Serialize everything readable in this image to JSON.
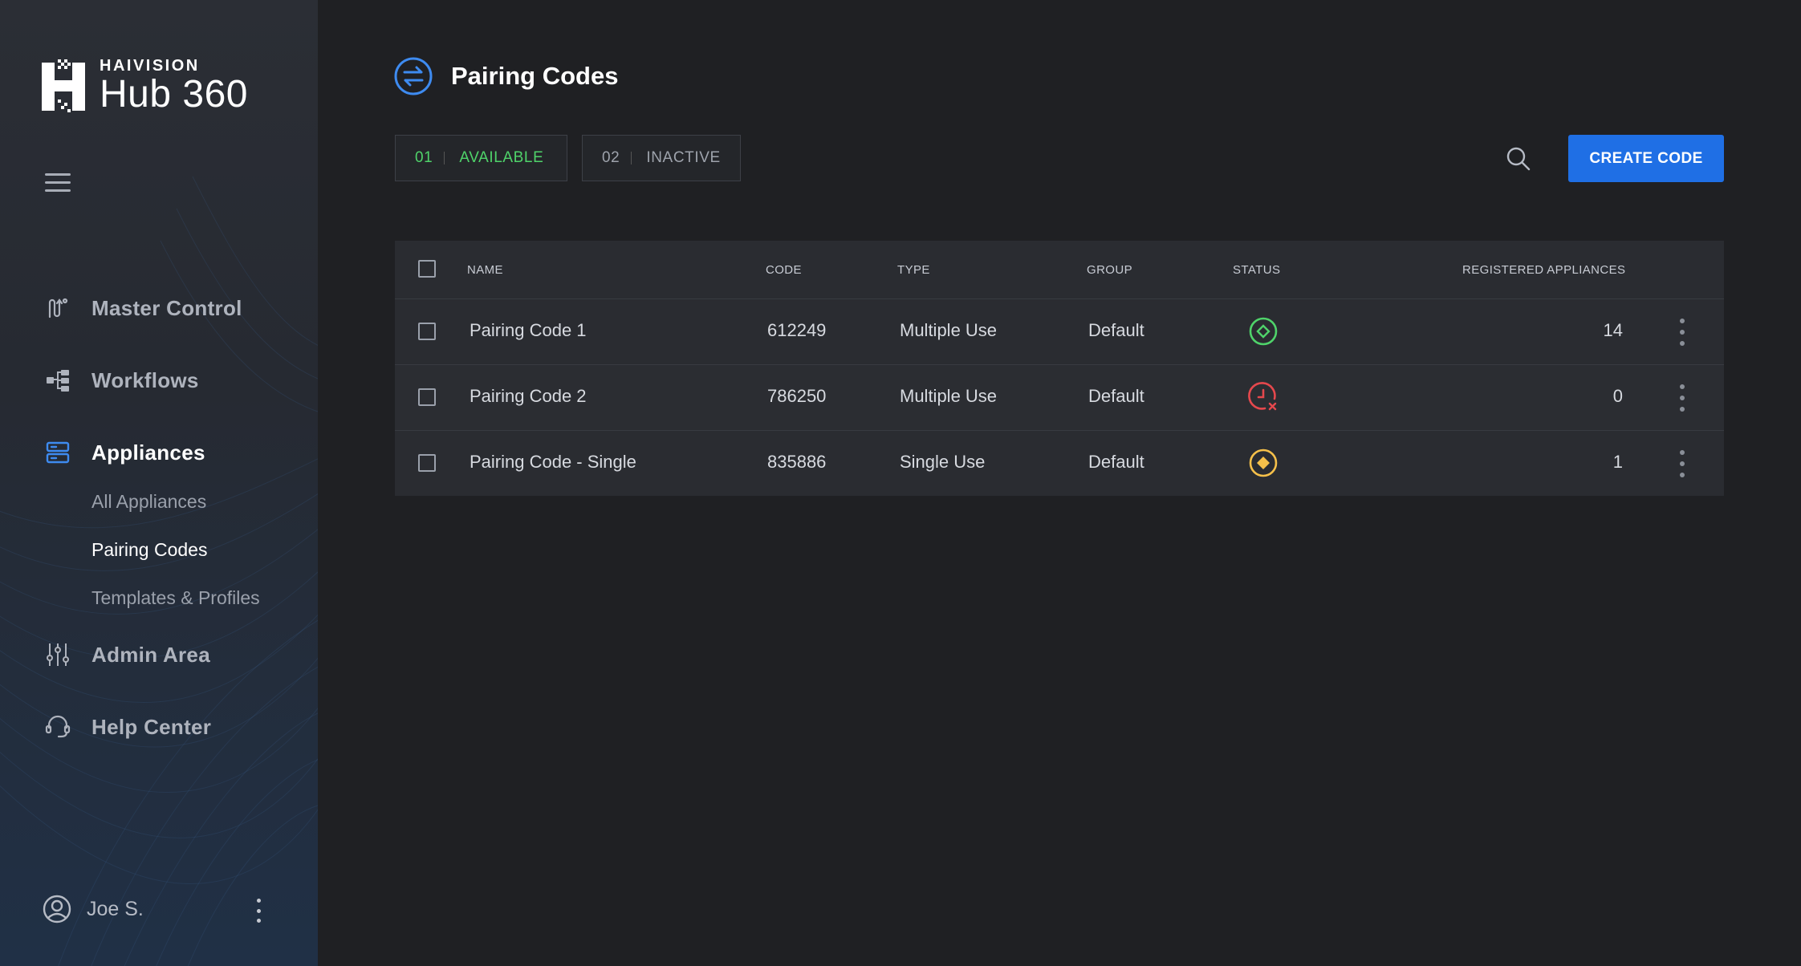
{
  "brand": {
    "company": "HAIVISION",
    "product": "Hub 360"
  },
  "sidebar": {
    "nav": [
      {
        "label": "Master Control",
        "icon": "master-control-icon"
      },
      {
        "label": "Workflows",
        "icon": "workflows-icon"
      },
      {
        "label": "Appliances",
        "icon": "appliances-icon",
        "active": true
      },
      {
        "label": "Admin Area",
        "icon": "sliders-icon"
      },
      {
        "label": "Help Center",
        "icon": "headset-icon"
      }
    ],
    "appliance_sub": [
      {
        "label": "All Appliances"
      },
      {
        "label": "Pairing Codes",
        "active": true
      },
      {
        "label": "Templates & Profiles"
      }
    ],
    "user": {
      "name": "Joe S."
    }
  },
  "page": {
    "title": "Pairing Codes",
    "tabs": [
      {
        "num": "01",
        "label": "AVAILABLE",
        "active": true
      },
      {
        "num": "02",
        "label": "INACTIVE",
        "active": false
      }
    ],
    "create_label": "CREATE CODE"
  },
  "table": {
    "columns": [
      "NAME",
      "CODE",
      "TYPE",
      "GROUP",
      "STATUS",
      "REGISTERED APPLIANCES"
    ],
    "rows": [
      {
        "name": "Pairing Code 1",
        "code": "612249",
        "type": "Multiple Use",
        "group": "Default",
        "status": "active",
        "registered": "14"
      },
      {
        "name": "Pairing Code 2",
        "code": "786250",
        "type": "Multiple Use",
        "group": "Default",
        "status": "expired",
        "registered": "0"
      },
      {
        "name": "Pairing Code - Single",
        "code": "835886",
        "type": "Single Use",
        "group": "Default",
        "status": "single",
        "registered": "1"
      }
    ]
  },
  "colors": {
    "accent": "#1f6fe5",
    "available": "#4fd36a",
    "status_active": "#4fd36a",
    "status_expired": "#e5484d",
    "status_single": "#f5c04a"
  }
}
